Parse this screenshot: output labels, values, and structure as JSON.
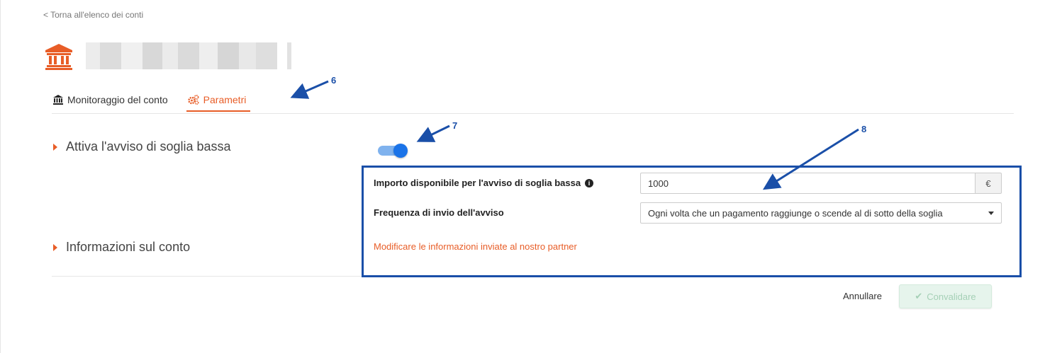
{
  "breadcrumb": {
    "back_label": "< Torna all'elenco dei conti"
  },
  "header": {
    "bank_icon": "bank-icon",
    "account_name_blurred": true
  },
  "tabs": [
    {
      "label": "Monitoraggio del conto",
      "icon": "bank-icon",
      "active": false
    },
    {
      "label": "Parametri",
      "icon": "gears-icon",
      "active": true
    }
  ],
  "sections": {
    "low_threshold": {
      "title": "Attiva l'avviso di soglia bassa",
      "toggle_on": true
    },
    "account_info": {
      "title": "Informazioni sul conto"
    }
  },
  "form": {
    "amount_label": "Importo disponibile per l'avviso di soglia bassa",
    "amount_value": "1000",
    "currency": "€",
    "frequency_label": "Frequenza di invio dell'avviso",
    "frequency_value": "Ogni volta che un pagamento raggiunge o scende al di sotto della soglia",
    "partner_link": "Modificare le informazioni inviate al nostro partner"
  },
  "actions": {
    "cancel": "Annullare",
    "validate": "Convalidare"
  },
  "annotations": {
    "n6": "6",
    "n7": "7",
    "n8": "8"
  },
  "colors": {
    "accent": "#e85d27",
    "toggle": "#1a73e8",
    "callout": "#1a4fa8",
    "validate_bg": "#e6f4ec"
  }
}
